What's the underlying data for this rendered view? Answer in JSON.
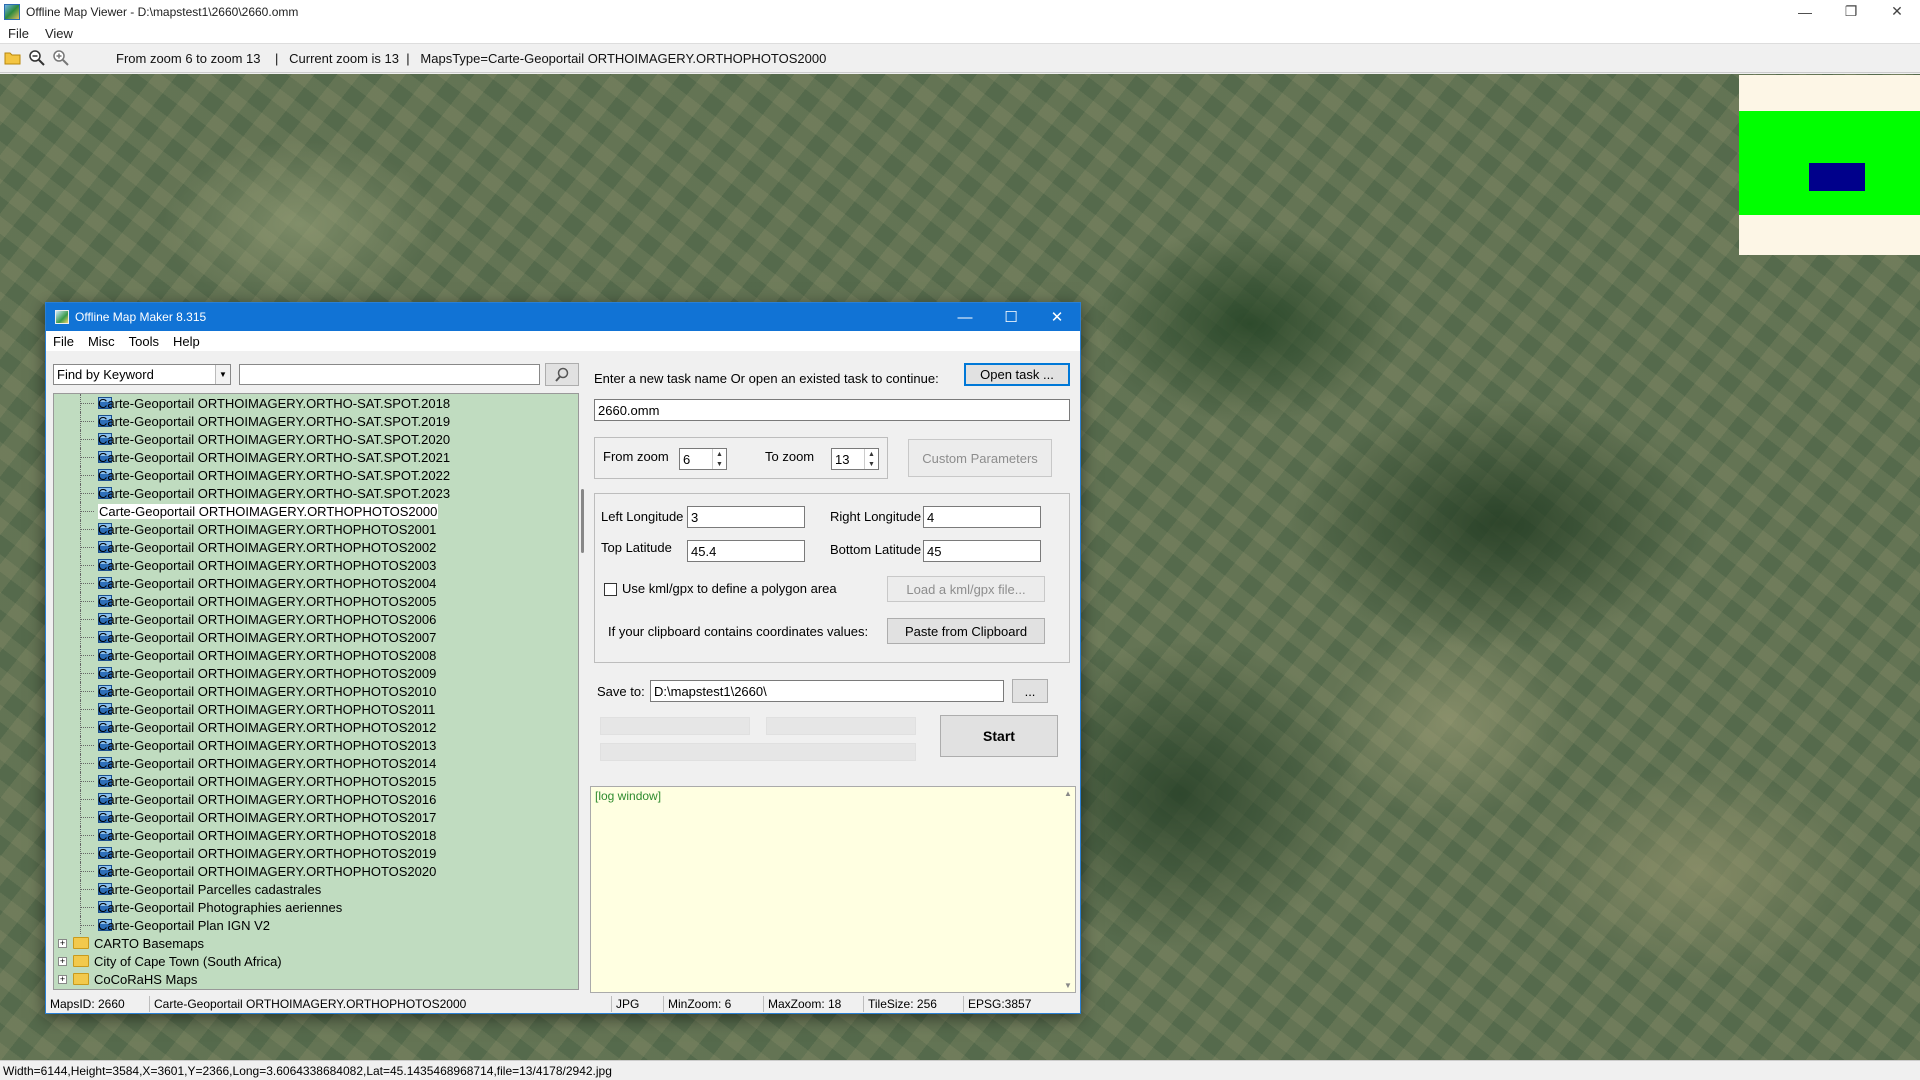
{
  "window": {
    "title": "Offline Map Viewer - D:\\mapstest1\\2660\\2660.omm",
    "menu": [
      "File",
      "View"
    ]
  },
  "toolbar": {
    "status_text": "From zoom 6 to zoom 13    |   Current zoom is 13  |   MapsType=Carte-Geoportail ORTHOIMAGERY.ORTHOPHOTOS2000",
    "icons": [
      "open-folder-icon",
      "zoom-out-icon",
      "zoom-in-icon"
    ]
  },
  "minimap": {
    "bg_color": "#fdf6e6",
    "area_color": "#00ff00",
    "view_color": "#00008b"
  },
  "statusbar": {
    "text": "Width=6144,Height=3584,X=3601,Y=2366,Long=3.6064338684082,Lat=45.1435468968714,file=13/4178/2942.jpg"
  },
  "dialog": {
    "title": "Offline Map Maker 8.315",
    "menu": [
      "File",
      "Misc",
      "Tools",
      "Help"
    ],
    "search": {
      "mode": "Find by Keyword",
      "query": ""
    },
    "tree": {
      "leaves": [
        "Carte-Geoportail ORTHOIMAGERY.ORTHO-SAT.SPOT.2018",
        "Carte-Geoportail ORTHOIMAGERY.ORTHO-SAT.SPOT.2019",
        "Carte-Geoportail ORTHOIMAGERY.ORTHO-SAT.SPOT.2020",
        "Carte-Geoportail ORTHOIMAGERY.ORTHO-SAT.SPOT.2021",
        "Carte-Geoportail ORTHOIMAGERY.ORTHO-SAT.SPOT.2022",
        "Carte-Geoportail ORTHOIMAGERY.ORTHO-SAT.SPOT.2023",
        "Carte-Geoportail ORTHOIMAGERY.ORTHOPHOTOS2000",
        "Carte-Geoportail ORTHOIMAGERY.ORTHOPHOTOS2001",
        "Carte-Geoportail ORTHOIMAGERY.ORTHOPHOTOS2002",
        "Carte-Geoportail ORTHOIMAGERY.ORTHOPHOTOS2003",
        "Carte-Geoportail ORTHOIMAGERY.ORTHOPHOTOS2004",
        "Carte-Geoportail ORTHOIMAGERY.ORTHOPHOTOS2005",
        "Carte-Geoportail ORTHOIMAGERY.ORTHOPHOTOS2006",
        "Carte-Geoportail ORTHOIMAGERY.ORTHOPHOTOS2007",
        "Carte-Geoportail ORTHOIMAGERY.ORTHOPHOTOS2008",
        "Carte-Geoportail ORTHOIMAGERY.ORTHOPHOTOS2009",
        "Carte-Geoportail ORTHOIMAGERY.ORTHOPHOTOS2010",
        "Carte-Geoportail ORTHOIMAGERY.ORTHOPHOTOS2011",
        "Carte-Geoportail ORTHOIMAGERY.ORTHOPHOTOS2012",
        "Carte-Geoportail ORTHOIMAGERY.ORTHOPHOTOS2013",
        "Carte-Geoportail ORTHOIMAGERY.ORTHOPHOTOS2014",
        "Carte-Geoportail ORTHOIMAGERY.ORTHOPHOTOS2015",
        "Carte-Geoportail ORTHOIMAGERY.ORTHOPHOTOS2016",
        "Carte-Geoportail ORTHOIMAGERY.ORTHOPHOTOS2017",
        "Carte-Geoportail ORTHOIMAGERY.ORTHOPHOTOS2018",
        "Carte-Geoportail ORTHOIMAGERY.ORTHOPHOTOS2019",
        "Carte-Geoportail ORTHOIMAGERY.ORTHOPHOTOS2020",
        "Carte-Geoportail Parcelles cadastrales",
        "Carte-Geoportail Photographies aeriennes",
        "Carte-Geoportail Plan IGN V2"
      ],
      "selected_index": 6,
      "folders": [
        "CARTO Basemaps",
        "City of Cape Town (South Africa)",
        "CoCoRaHS Maps"
      ],
      "bg_color": "#c0dcc0"
    },
    "task": {
      "prompt": "Enter a new task name Or open an existed task to continue:",
      "open_button": "Open task ...",
      "name": "2660.omm"
    },
    "zoom": {
      "from_label": "From zoom",
      "from_value": "6",
      "to_label": "To zoom",
      "to_value": "13",
      "custom_button": "Custom Parameters"
    },
    "bounds": {
      "left_lon_label": "Left Longitude",
      "left_lon": "3",
      "right_lon_label": "Right Longitude",
      "right_lon": "4",
      "top_lat_label": "Top Latitude",
      "top_lat": "45.4",
      "bottom_lat_label": "Bottom Latitude",
      "bottom_lat": "45",
      "kml_checkbox_label": "Use kml/gpx to define a polygon area",
      "kml_checked": false,
      "kml_button": "Load a kml/gpx file...",
      "clipboard_label": "If your clipboard contains coordinates values:",
      "clipboard_button": "Paste from Clipboard"
    },
    "save": {
      "label": "Save to:",
      "path": "D:\\mapstest1\\2660\\",
      "browse_button": "...",
      "start_button": "Start"
    },
    "log": {
      "text": "[log window]"
    },
    "status": {
      "maps_id": "MapsID: 2660",
      "maps_name": "Carte-Geoportail ORTHOIMAGERY.ORTHOPHOTOS2000",
      "format": "JPG",
      "min_zoom": "MinZoom: 6",
      "max_zoom": "MaxZoom: 18",
      "tile_size": "TileSize: 256",
      "epsg": "EPSG:3857"
    }
  }
}
